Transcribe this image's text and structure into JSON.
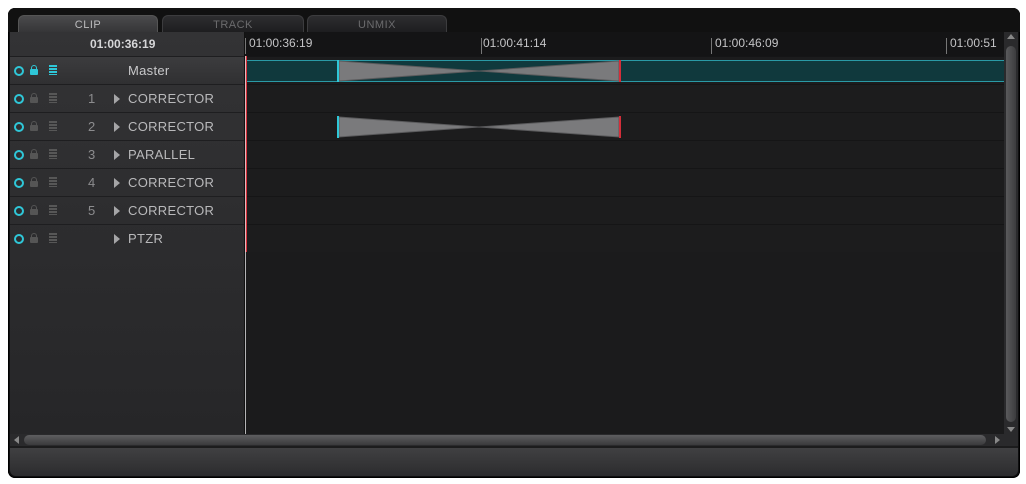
{
  "tabs": [
    {
      "label": "CLIP",
      "active": true
    },
    {
      "label": "TRACK",
      "active": false
    },
    {
      "label": "UNMIX",
      "active": false
    }
  ],
  "current_timecode": "01:00:36:19",
  "ruler_labels": [
    "01:00:36:19",
    "01:00:41:14",
    "01:00:46:09",
    "01:00:51"
  ],
  "tracks": [
    {
      "number": "",
      "name": "Master",
      "has_arrow": false,
      "master": true
    },
    {
      "number": "1",
      "name": "CORRECTOR",
      "has_arrow": true
    },
    {
      "number": "2",
      "name": "CORRECTOR",
      "has_arrow": true
    },
    {
      "number": "3",
      "name": "PARALLEL",
      "has_arrow": true
    },
    {
      "number": "4",
      "name": "CORRECTOR",
      "has_arrow": true
    },
    {
      "number": "5",
      "name": "CORRECTOR",
      "has_arrow": true
    },
    {
      "number": "",
      "name": "PTZR",
      "has_arrow": true
    }
  ],
  "icons": {
    "visibility": "circle-icon",
    "lock": "lock-icon",
    "layers": "bars-icon",
    "expand": "play-arrow-icon"
  },
  "colors": {
    "accent": "#2fc7d8",
    "playhead": "#d42e3a",
    "background": "#1c1c1d"
  }
}
